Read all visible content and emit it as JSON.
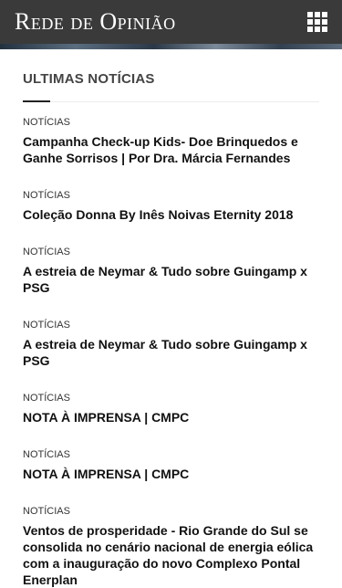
{
  "header": {
    "logo_text": "Rede de Opinião",
    "menu_icon": "grid-menu-icon"
  },
  "section": {
    "title": "ULTIMAS NOTÍCIAS"
  },
  "news": [
    {
      "category": "NOTÍCIAS",
      "title": "Campanha Check-up Kids- Doe Brinquedos e Ganhe Sorrisos | Por Dra. Márcia Fernandes"
    },
    {
      "category": "NOTÍCIAS",
      "title": "Coleção Donna By Inês Noivas Eternity 2018"
    },
    {
      "category": "NOTÍCIAS",
      "title": "A estreia de Neymar & Tudo sobre Guingamp x PSG"
    },
    {
      "category": "NOTÍCIAS",
      "title": "A estreia de Neymar & Tudo sobre Guingamp x PSG"
    },
    {
      "category": "NOTÍCIAS",
      "title": "NOTA À IMPRENSA | CMPC"
    },
    {
      "category": "NOTÍCIAS",
      "title": "NOTA À IMPRENSA | CMPC"
    },
    {
      "category": "NOTÍCIAS",
      "title": "Ventos de prosperidade - Rio Grande do Sul se consolida no cenário nacional de energia eólica com a inauguração do novo Complexo Pontal Enerplan"
    }
  ]
}
